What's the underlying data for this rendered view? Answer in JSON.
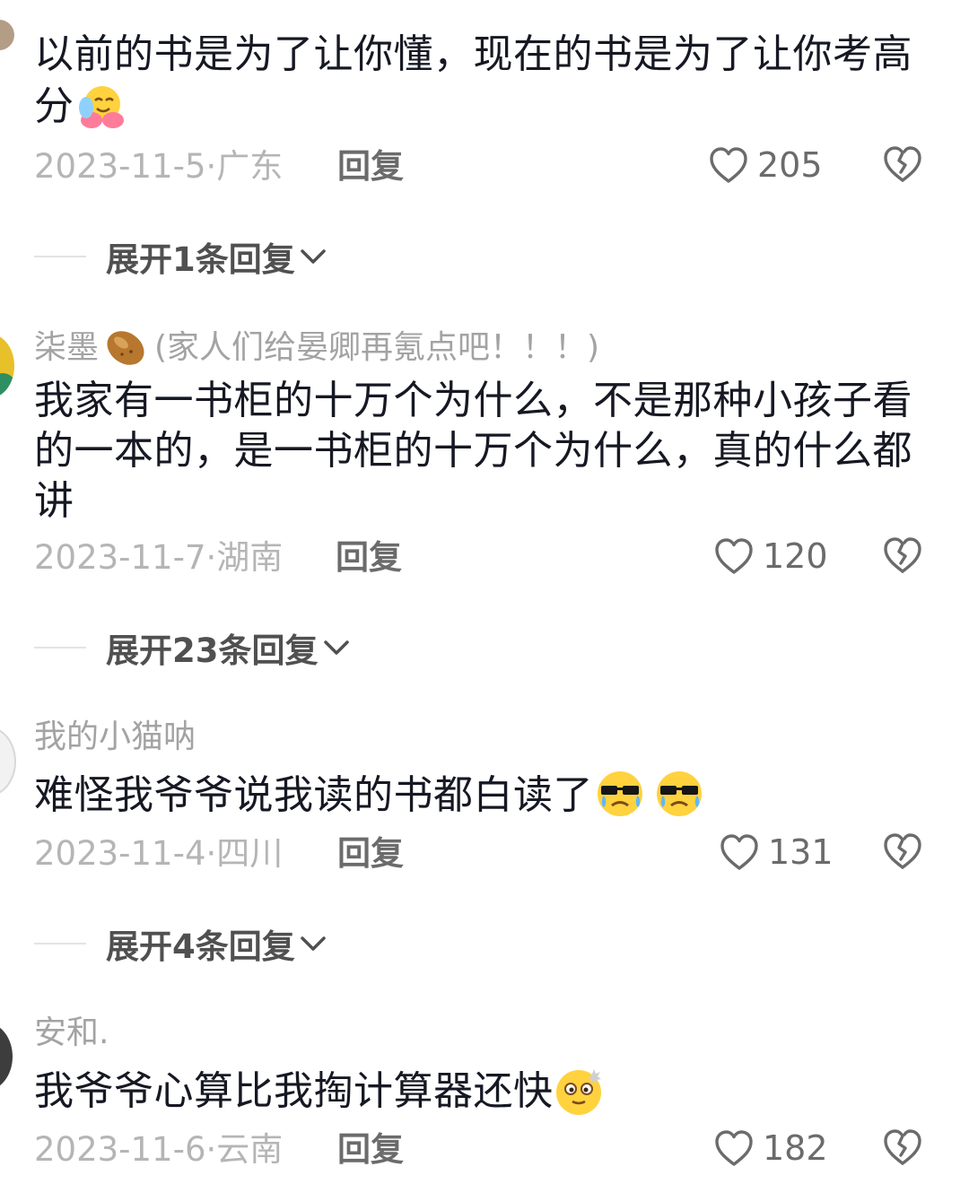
{
  "comments": [
    {
      "text_lines": [
        "以前的书是为了让你懂，现在的书是为了让你考高",
        "分"
      ],
      "emoji": "hugging-face-emoji",
      "date": "2023-11-5",
      "region": "广东",
      "reply_label": "回复",
      "likes": "205",
      "expand_label": "展开1条回复"
    },
    {
      "username": "柒墨",
      "username_note": "(家人们给晏卿再氪点吧！！！)",
      "text_lines": [
        "我家有一书柜的十万个为什么，不是那种小孩子看",
        "的一本的，是一书柜的十万个为什么，真的什么都",
        "讲"
      ],
      "date": "2023-11-7",
      "region": "湖南",
      "reply_label": "回复",
      "likes": "120",
      "expand_label": "展开23条回复"
    },
    {
      "username": "我的小猫呐",
      "text_lines": [
        "难怪我爷爷说我读的书都白读了"
      ],
      "emoji": "crying-sunglasses-emoji",
      "date": "2023-11-4",
      "region": "四川",
      "reply_label": "回复",
      "likes": "131",
      "expand_label": "展开4条回复"
    },
    {
      "username": "安和.",
      "text_lines": [
        "我爷爷心算比我掏计算器还快"
      ],
      "emoji": "dizzy-face-emoji",
      "date": "2023-11-6",
      "region": "云南",
      "reply_label": "回复",
      "likes": "182"
    }
  ],
  "colors": {
    "text": "#161823",
    "muted": "#a3a3a3",
    "reply": "#6b6b6b"
  }
}
